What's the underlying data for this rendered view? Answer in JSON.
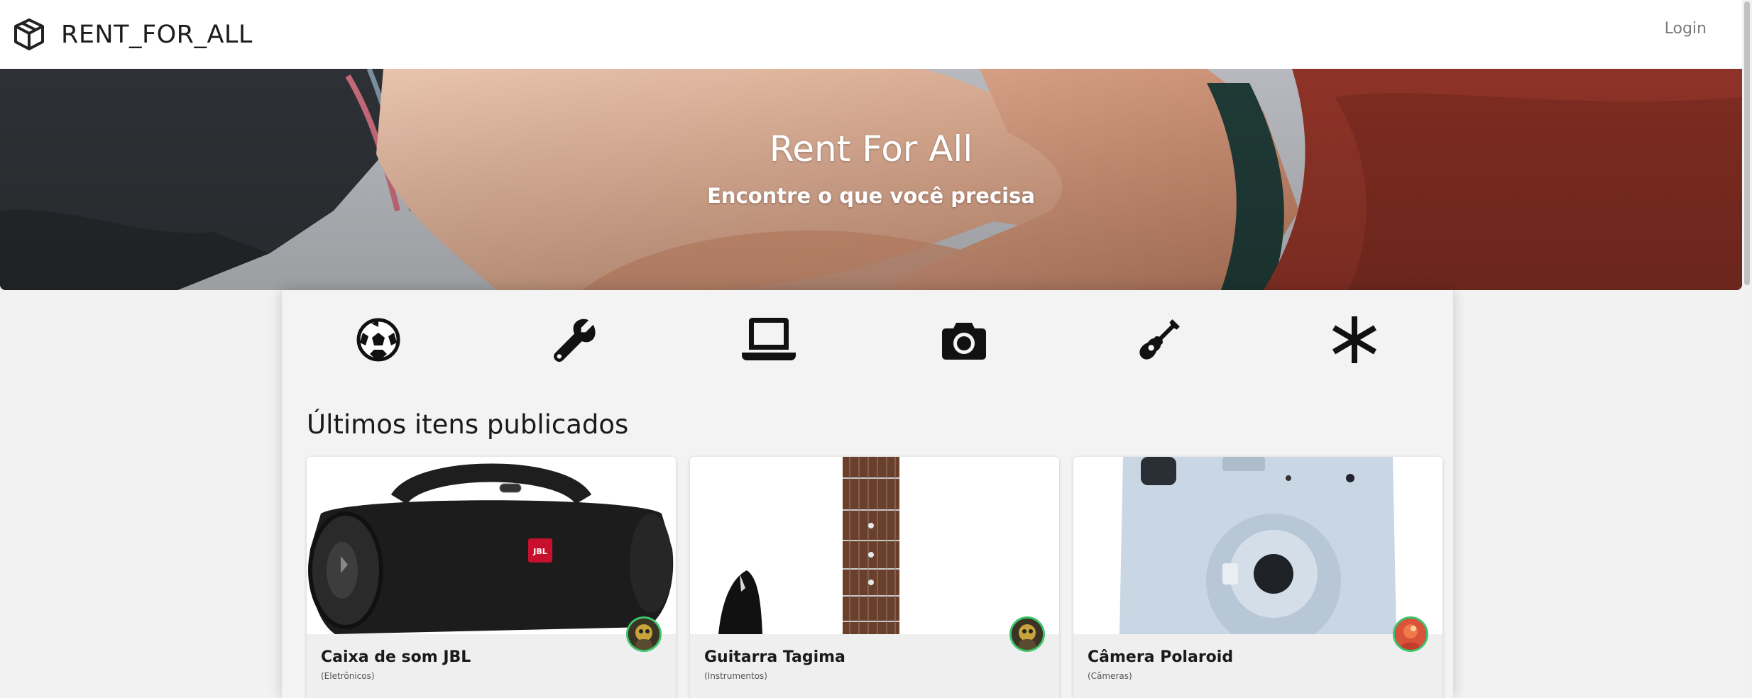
{
  "header": {
    "brand": "RENT_FOR_ALL",
    "brand_icon": "box-icon",
    "login_label": "Login"
  },
  "hero": {
    "title": "Rent For All",
    "subtitle": "Encontre o que você precisa"
  },
  "categories": [
    {
      "icon": "soccer-ball-icon"
    },
    {
      "icon": "wrench-icon"
    },
    {
      "icon": "laptop-icon"
    },
    {
      "icon": "camera-icon"
    },
    {
      "icon": "guitar-icon"
    },
    {
      "icon": "asterisk-icon"
    }
  ],
  "latest": {
    "title": "Últimos itens publicados",
    "items": [
      {
        "name": "Caixa de som JBL",
        "category": "(Eletrônicos)",
        "image": "jbl-speaker-image",
        "avatar": "owner-avatar"
      },
      {
        "name": "Guitarra Tagima",
        "category": "(Instrumentos)",
        "image": "guitar-image",
        "avatar": "owner-avatar"
      },
      {
        "name": "Câmera Polaroid",
        "category": "(Câmeras)",
        "image": "polaroid-camera-image",
        "avatar": "owner-avatar"
      }
    ]
  },
  "colors": {
    "avatar_ring": "#3ec46d",
    "page_bg": "#f2f2f2",
    "text_dark": "#1a1a1a"
  }
}
